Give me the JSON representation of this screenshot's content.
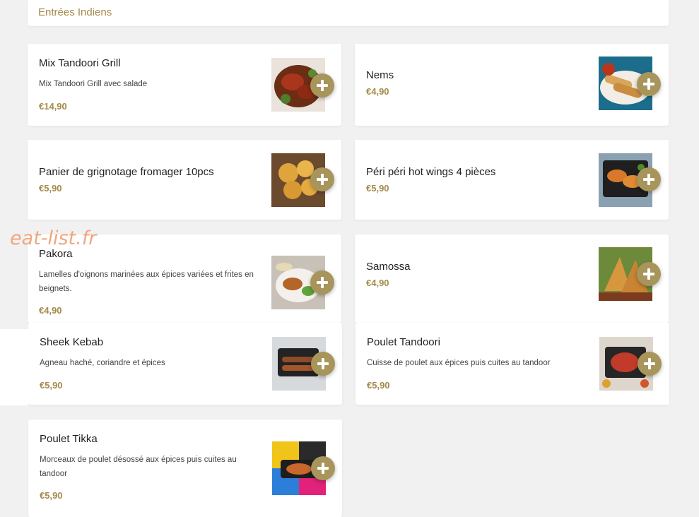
{
  "section": {
    "title": "Entrées Indiens"
  },
  "watermark": "eat-list.fr",
  "add_icon": "plus-icon",
  "colors": {
    "accent": "#a58a4a",
    "add_button": "#a8955c",
    "background": "#f1f1f1"
  },
  "items": [
    {
      "name": "Mix Tandoori Grill",
      "desc": "Mix Tandoori Grill avec salade",
      "price": "€14,90",
      "image": "grilled-meat-plate"
    },
    {
      "name": "Nems",
      "desc": "",
      "price": "€4,90",
      "image": "spring-rolls"
    },
    {
      "name": "Panier de grignotage fromager 10pcs",
      "desc": "",
      "price": "€5,90",
      "image": "cheese-bites"
    },
    {
      "name": "Péri péri hot wings 4 pièces",
      "desc": "",
      "price": "€5,90",
      "image": "chicken-wings"
    },
    {
      "name": "Pakora",
      "desc": "Lamelles d'oignons marinées aux épices variées et frites en beignets.",
      "price": "€4,90",
      "image": "pakora-plate"
    },
    {
      "name": "Samossa",
      "desc": "",
      "price": "€4,90",
      "image": "samosas"
    },
    {
      "name": "Sheek Kebab",
      "desc": "Agneau haché, coriandre et épices",
      "price": "€5,90",
      "image": "kebab-skillet"
    },
    {
      "name": "Poulet Tandoori",
      "desc": "Cuisse de poulet aux épices puis cuites au tandoor",
      "price": "€5,90",
      "image": "tandoori-chicken-skillet"
    },
    {
      "name": "Poulet Tikka",
      "desc": "Morceaux de poulet désossé aux épices puis cuites au tandoor",
      "price": "€5,90",
      "image": "tikka-skillet"
    }
  ]
}
